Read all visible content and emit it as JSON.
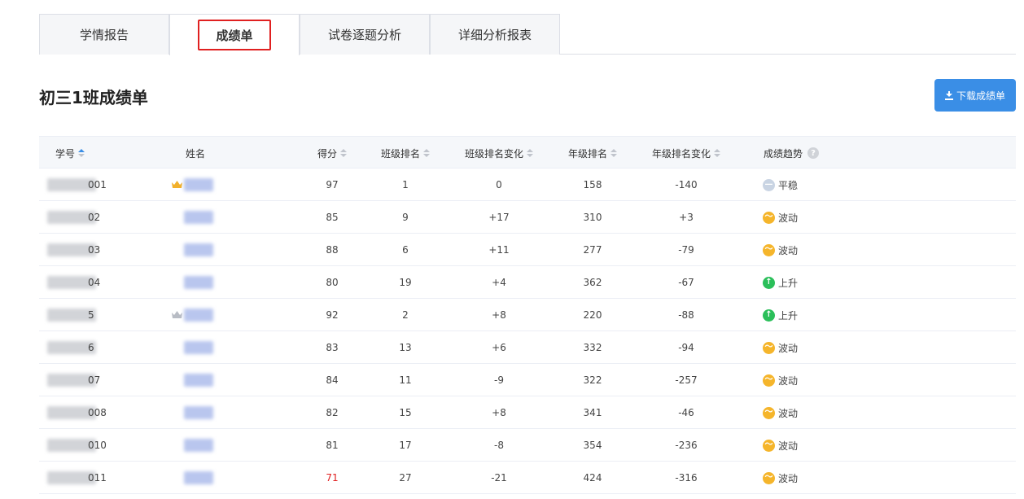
{
  "tabs": [
    {
      "label": "学情报告",
      "active": false
    },
    {
      "label": "成绩单",
      "active": true
    },
    {
      "label": "试卷逐题分析",
      "active": false
    },
    {
      "label": "详细分析报表",
      "active": false
    }
  ],
  "page_title": "初三1班成绩单",
  "download_label": "下载成绩单",
  "columns": [
    "学号",
    "姓名",
    "得分",
    "班级排名",
    "班级排名变化",
    "年级排名",
    "年级排名变化",
    "成绩趋势"
  ],
  "help_glyph": "?",
  "rows": [
    {
      "id_suffix": "001",
      "score": "97",
      "class_rank": "1",
      "class_change": "0",
      "grade_rank": "158",
      "grade_change": "-140",
      "trend": "平稳",
      "trend_type": "flat",
      "crown": "gold"
    },
    {
      "id_suffix": "02",
      "score": "85",
      "class_rank": "9",
      "class_change": "+17",
      "grade_rank": "310",
      "grade_change": "+3",
      "trend": "波动",
      "trend_type": "wave",
      "crown": ""
    },
    {
      "id_suffix": "03",
      "score": "88",
      "class_rank": "6",
      "class_change": "+11",
      "grade_rank": "277",
      "grade_change": "-79",
      "trend": "波动",
      "trend_type": "wave",
      "crown": ""
    },
    {
      "id_suffix": "04",
      "score": "80",
      "class_rank": "19",
      "class_change": "+4",
      "grade_rank": "362",
      "grade_change": "-67",
      "trend": "上升",
      "trend_type": "up",
      "crown": ""
    },
    {
      "id_suffix": "5",
      "score": "92",
      "class_rank": "2",
      "class_change": "+8",
      "grade_rank": "220",
      "grade_change": "-88",
      "trend": "上升",
      "trend_type": "up",
      "crown": "silver"
    },
    {
      "id_suffix": "6",
      "score": "83",
      "class_rank": "13",
      "class_change": "+6",
      "grade_rank": "332",
      "grade_change": "-94",
      "trend": "波动",
      "trend_type": "wave",
      "crown": ""
    },
    {
      "id_suffix": "07",
      "score": "84",
      "class_rank": "11",
      "class_change": "-9",
      "grade_rank": "322",
      "grade_change": "-257",
      "trend": "波动",
      "trend_type": "wave",
      "crown": ""
    },
    {
      "id_suffix": "008",
      "score": "82",
      "class_rank": "15",
      "class_change": "+8",
      "grade_rank": "341",
      "grade_change": "-46",
      "trend": "波动",
      "trend_type": "wave",
      "crown": ""
    },
    {
      "id_suffix": "010",
      "score": "81",
      "class_rank": "17",
      "class_change": "-8",
      "grade_rank": "354",
      "grade_change": "-236",
      "trend": "波动",
      "trend_type": "wave",
      "crown": ""
    },
    {
      "id_suffix": "011",
      "score": "71",
      "class_rank": "27",
      "class_change": "-21",
      "grade_rank": "424",
      "grade_change": "-316",
      "trend": "波动",
      "trend_type": "wave",
      "crown": "",
      "low": true
    }
  ],
  "colors": {
    "accent": "#3a8ee6",
    "highlight_box": "#e02020",
    "low_score": "#e02020",
    "trend_wave": "#f5b52b",
    "trend_up": "#2bbf5a",
    "trend_flat": "#c9d4e3"
  },
  "icons": {
    "download": "download-icon",
    "sort": "sort-caret-icon",
    "help": "help-circle-icon",
    "crown": "crown-icon",
    "trend_wave": "wave-icon",
    "trend_up": "arrow-up-icon",
    "trend_flat": "flat-icon"
  }
}
